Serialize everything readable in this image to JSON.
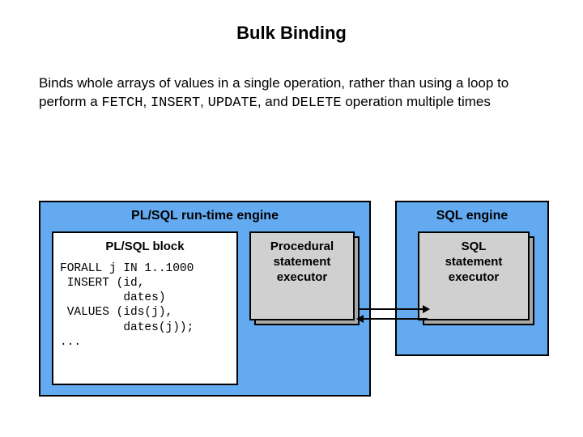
{
  "title": "Bulk Binding",
  "description": {
    "line1_pre": "Binds whole arrays of values in a single operation, rather than using a loop to perform a ",
    "kw1": "FETCH",
    "sep1": ", ",
    "kw2": "INSERT",
    "sep2": ", ",
    "kw3": "UPDATE",
    "sep3": ", and ",
    "kw4": "DELETE",
    "line1_post": " operation multiple times"
  },
  "plsql_engine": {
    "title": "PL/SQL run-time engine",
    "block_title": "PL/SQL block",
    "code": "FORALL j IN 1..1000\n INSERT (id,\n         dates)\n VALUES (ids(j),\n         dates(j));\n...",
    "executor_l1": "Procedural",
    "executor_l2": "statement",
    "executor_l3": "executor"
  },
  "sql_engine": {
    "title": "SQL engine",
    "executor_l1": "SQL",
    "executor_l2": "statement",
    "executor_l3": "executor"
  }
}
